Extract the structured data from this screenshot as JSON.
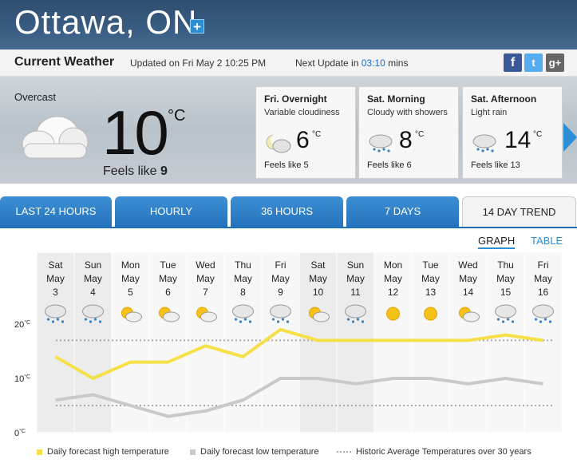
{
  "header": {
    "city": "Ottawa, ON",
    "add_label": "+"
  },
  "current_bar": {
    "title": "Current Weather",
    "updated": "Updated on Fri May 2 10:25 PM",
    "next_update_label": "Next Update in",
    "countdown": "03:10",
    "countdown_unit": "mins",
    "social": [
      {
        "name": "facebook",
        "glyph": "f",
        "color": "#3b5998"
      },
      {
        "name": "twitter",
        "glyph": "t",
        "color": "#55acee"
      },
      {
        "name": "google-plus",
        "glyph": "g+",
        "color": "#666666"
      }
    ]
  },
  "current": {
    "condition": "Overcast",
    "temp": "10",
    "unit": "°C",
    "feels_label": "Feels like",
    "feels_value": "9"
  },
  "forecast_cards": [
    {
      "title": "Fri. Overnight",
      "desc": "Variable cloudiness",
      "temp": "6",
      "unit": "°C",
      "feels": "Feels like 5",
      "icon": "moon-cloud-icon"
    },
    {
      "title": "Sat. Morning",
      "desc": "Cloudy with showers",
      "temp": "8",
      "unit": "°C",
      "feels": "Feels like 6",
      "icon": "rain-cloud-icon"
    },
    {
      "title": "Sat. Afternoon",
      "desc": "Light rain",
      "temp": "14",
      "unit": "°C",
      "feels": "Feels like 13",
      "icon": "rain-cloud-icon"
    }
  ],
  "tabs": [
    "LAST 24 HOURS",
    "HOURLY",
    "36 HOURS",
    "7 DAYS",
    "14 DAY TREND"
  ],
  "active_tab": "14 DAY TREND",
  "view_toggle": {
    "graph": "GRAPH",
    "table": "TABLE"
  },
  "days": [
    {
      "dow": "Sat",
      "mon": "May",
      "day": "3",
      "icon": "rain"
    },
    {
      "dow": "Sun",
      "mon": "May",
      "day": "4",
      "icon": "rain"
    },
    {
      "dow": "Mon",
      "mon": "May",
      "day": "5",
      "icon": "sun-cloud"
    },
    {
      "dow": "Tue",
      "mon": "May",
      "day": "6",
      "icon": "sun-cloud"
    },
    {
      "dow": "Wed",
      "mon": "May",
      "day": "7",
      "icon": "sun-cloud"
    },
    {
      "dow": "Thu",
      "mon": "May",
      "day": "8",
      "icon": "rain"
    },
    {
      "dow": "Fri",
      "mon": "May",
      "day": "9",
      "icon": "rain"
    },
    {
      "dow": "Sat",
      "mon": "May",
      "day": "10",
      "icon": "sun-cloud"
    },
    {
      "dow": "Sun",
      "mon": "May",
      "day": "11",
      "icon": "rain"
    },
    {
      "dow": "Mon",
      "mon": "May",
      "day": "12",
      "icon": "sun"
    },
    {
      "dow": "Tue",
      "mon": "May",
      "day": "13",
      "icon": "sun"
    },
    {
      "dow": "Wed",
      "mon": "May",
      "day": "14",
      "icon": "sun-cloud"
    },
    {
      "dow": "Thu",
      "mon": "May",
      "day": "15",
      "icon": "rain"
    },
    {
      "dow": "Fri",
      "mon": "May",
      "day": "16",
      "icon": "rain"
    }
  ],
  "chart_data": {
    "type": "line",
    "yticks": [
      "20",
      "10",
      "0"
    ],
    "ytick_values": [
      20,
      10,
      0
    ],
    "ytick_unit": "°C",
    "ylim": [
      0,
      20
    ],
    "series": [
      {
        "name": "Daily forecast high temperature",
        "color": "#f5e04a",
        "values": [
          14,
          10,
          13,
          13,
          16,
          14,
          19,
          17,
          17,
          17,
          17,
          17,
          18,
          17
        ]
      },
      {
        "name": "Daily forecast low temperature",
        "color": "#c9c9c9",
        "values": [
          6,
          7,
          5,
          3,
          4,
          6,
          10,
          10,
          9,
          10,
          10,
          9,
          10,
          9
        ]
      },
      {
        "name": "Historic Average Temperatures over 30 years",
        "color": "#aaaaaa",
        "high_avg": 17,
        "low_avg": 5
      }
    ],
    "legend_position": "bottom"
  },
  "colors": {
    "accent": "#2a8fd6",
    "tab_blue": "#2673bd",
    "countdown": "#1a6fc0"
  }
}
